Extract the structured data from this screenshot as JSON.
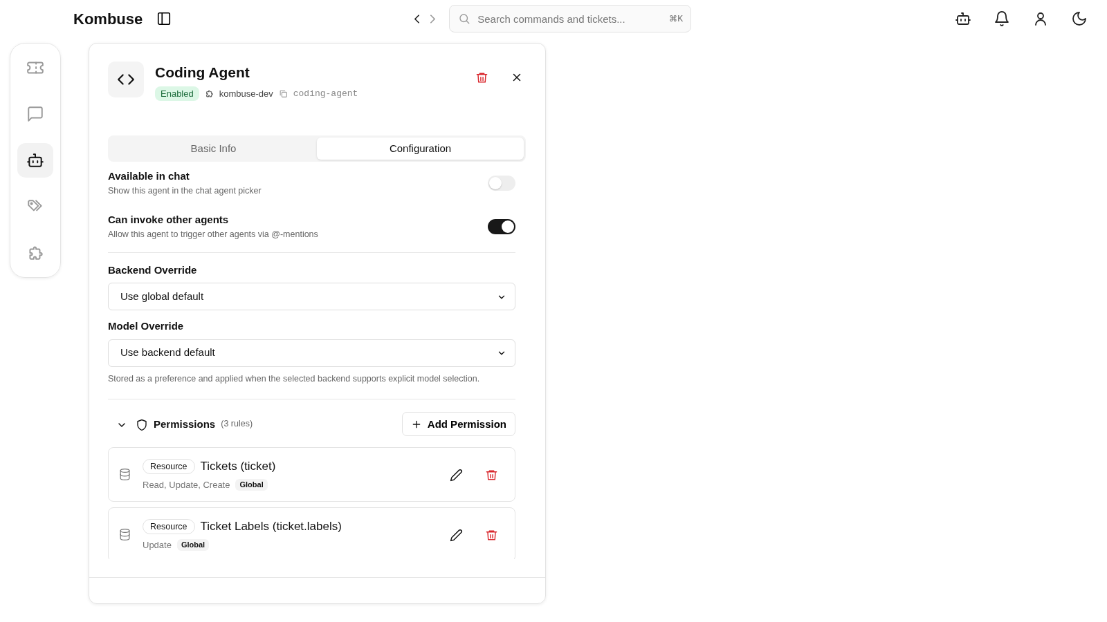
{
  "header": {
    "brand": "Kombuse",
    "search": {
      "placeholder": "Search commands and tickets...",
      "shortcut": "⌘K"
    }
  },
  "sidebar": {
    "items": [
      {
        "kind": "ticket",
        "selected": false
      },
      {
        "kind": "chat",
        "selected": false
      },
      {
        "kind": "robot",
        "selected": true
      },
      {
        "kind": "tags",
        "selected": false
      },
      {
        "kind": "puzzle",
        "selected": false
      }
    ]
  },
  "agent": {
    "name": "Coding Agent",
    "status": "Enabled",
    "plugin": "kombuse-dev",
    "slug": "coding-agent"
  },
  "tabs": [
    {
      "label": "Basic Info",
      "selected": false
    },
    {
      "label": "Configuration",
      "selected": true
    }
  ],
  "toggles": [
    {
      "label": "Available in chat",
      "description": "Show this agent in the chat agent picker",
      "on": false
    },
    {
      "label": "Can invoke other agents",
      "description": "Allow this agent to trigger other agents via @-mentions",
      "on": true
    }
  ],
  "selects": [
    {
      "label": "Backend Override",
      "value": "Use global default"
    },
    {
      "label": "Model Override",
      "value": "Use backend default",
      "help": "Stored as a preference and applied when the selected backend supports explicit model selection."
    }
  ],
  "permissions": {
    "title": "Permissions",
    "count": "(3 rules)",
    "expanded": true,
    "add_button": "Add Permission",
    "rules": [
      {
        "type": "Resource",
        "name": "Tickets (ticket)",
        "actions": "Read, Update, Create",
        "scope": "Global"
      },
      {
        "type": "Resource",
        "name": "Ticket Labels (ticket.labels)",
        "actions": "Update",
        "scope": "Global"
      }
    ]
  }
}
